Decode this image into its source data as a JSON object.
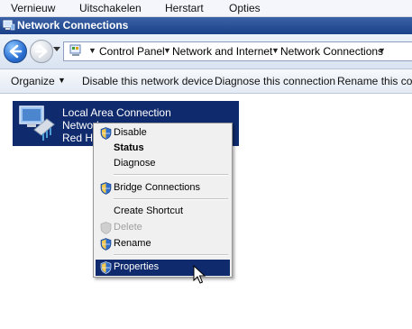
{
  "menubar": {
    "items": [
      "Vernieuw",
      "Uitschakelen",
      "Herstart",
      "Opties"
    ]
  },
  "window": {
    "title": "Network Connections"
  },
  "address": {
    "crumbs": [
      "Control Panel",
      "Network and Internet",
      "Network Connections"
    ]
  },
  "commands": {
    "items": [
      "Organize",
      "Disable this network device",
      "Diagnose this connection",
      "Rename this conn"
    ]
  },
  "connection": {
    "name": "Local Area Connection",
    "line2": "Network",
    "line3": "Red Hat"
  },
  "context_menu": {
    "items": [
      "Disable",
      "Status",
      "Diagnose",
      "Bridge Connections",
      "Create Shortcut",
      "Delete",
      "Rename",
      "Properties"
    ]
  },
  "colors": {
    "selection": "#0f2b6e",
    "titlebar": "#1a4189"
  }
}
